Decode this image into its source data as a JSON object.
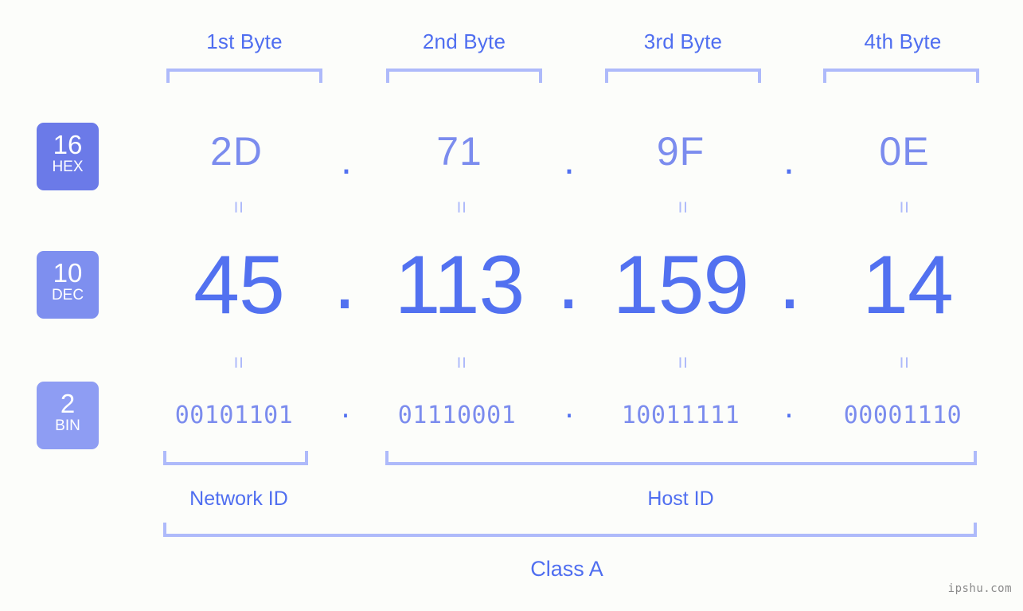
{
  "ip": {
    "dec_address": "45.113.159.14",
    "hex_address": "2D.71.9F.0E",
    "bin_address": "00101101.01110001.10011111.00001110",
    "class": "Class A"
  },
  "colors": {
    "background": "#fcfdfa",
    "accent_strong": "#4f6ef0",
    "accent_mid": "#7b8cee",
    "accent_light": "#aebafa",
    "badge_hex": "#6b7ae8",
    "badge_dec": "#7e8fef",
    "badge_bin": "#8e9df3",
    "watermark": "#8a8a8a"
  },
  "byte_headers": [
    {
      "label": "1st Byte"
    },
    {
      "label": "2nd Byte"
    },
    {
      "label": "3rd Byte"
    },
    {
      "label": "4th Byte"
    }
  ],
  "radix_badges": [
    {
      "num": "16",
      "sub": "HEX"
    },
    {
      "num": "10",
      "sub": "DEC"
    },
    {
      "num": "2",
      "sub": "BIN"
    }
  ],
  "rows": {
    "hex": {
      "name": "HEX",
      "base": "16",
      "values": [
        "2D",
        "71",
        "9F",
        "0E"
      ]
    },
    "dec": {
      "name": "DEC",
      "base": "10",
      "values": [
        "45",
        "113",
        "159",
        "14"
      ]
    },
    "bin": {
      "name": "BIN",
      "base": "2",
      "values": [
        "00101101",
        "01110001",
        "10011111",
        "00001110"
      ]
    }
  },
  "separator": ".",
  "equals_mark": "=",
  "sections": [
    {
      "label": "Network ID"
    },
    {
      "label": "Host ID"
    }
  ],
  "class_label": "Class A",
  "watermark": "ipshu.com"
}
